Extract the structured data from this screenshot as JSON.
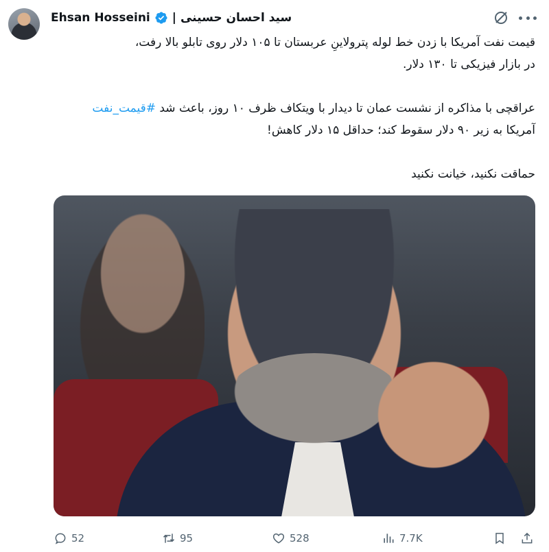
{
  "author": {
    "name_en": "Ehsan Hosseini",
    "separator": "|",
    "name_fa": "سید احسان حسینی"
  },
  "tweet": {
    "lines": [
      "قیمت نفت آمریکا با زدن خط لوله پترولاینِ عربستان تا ۱۰۵ دلار روی تابلو بالا رفت،",
      "در بازار فیزیکی تا ۱۳۰ دلار.",
      "عراقچی با مذاکره از نشست عمان تا دیدار با ویتکاف ظرف ۱۰ روز، باعث شد",
      "آمریکا به زیر ۹۰ دلار سقوط کند؛ حداقل ۱۵ دلار کاهش!",
      "حماقت نکنید، خیانت نکنید"
    ],
    "hashtag": "#قیمت_نفت"
  },
  "actions": {
    "replies": "52",
    "reposts": "95",
    "likes": "528",
    "views": "7.7K"
  },
  "icons": {
    "verified": "verified-badge-icon",
    "grok": "grok-icon",
    "more": "more-icon",
    "reply": "reply-icon",
    "repost": "repost-icon",
    "like": "heart-icon",
    "views": "views-icon",
    "bookmark": "bookmark-icon",
    "share": "share-icon"
  },
  "colors": {
    "link": "#1d9bf0",
    "muted": "#536471",
    "text": "#0f1419",
    "verified": "#1d9bf0"
  }
}
